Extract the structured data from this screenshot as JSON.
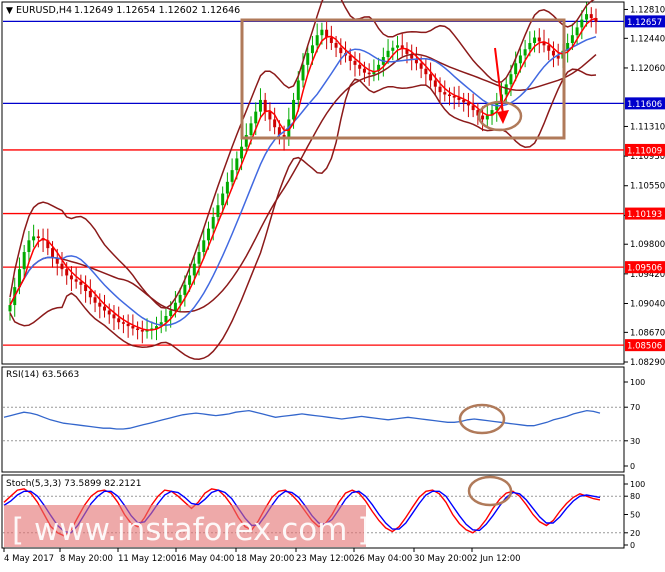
{
  "chart_data": [
    {
      "panel": "price",
      "type": "candlestick",
      "symbol_header": "EURUSD,H4",
      "ohlc_header": "1.12649 1.12654 1.12602 1.12646",
      "ylim": [
        1.0829,
        1.1288
      ],
      "price_ticks": [
        "1.12810",
        "1.12440",
        "1.12060",
        "1.11310",
        "1.10930",
        "1.10550",
        "1.10170",
        "1.09800",
        "1.09420",
        "1.09040",
        "1.08670",
        "1.08290"
      ],
      "horizontal_levels": [
        {
          "value": 1.12657,
          "label": "1.12657",
          "color": "#0000cc",
          "style": "line"
        },
        {
          "value": 1.11606,
          "label": "1.11606",
          "color": "#0000cc",
          "style": "line"
        },
        {
          "value": 1.11009,
          "label": "1.11009",
          "color": "#ff0000",
          "style": "line"
        },
        {
          "value": 1.10193,
          "label": "1.10193",
          "color": "#ff0000",
          "style": "line"
        },
        {
          "value": 1.09506,
          "label": "1.09506",
          "color": "#ff0000",
          "style": "line"
        },
        {
          "value": 1.08506,
          "label": "1.08506",
          "color": "#ff0000",
          "style": "line"
        }
      ],
      "x_labels": [
        "4 May 2017",
        "8 May 20:00",
        "11 May 12:00",
        "16 May 04:00",
        "18 May 20:00",
        "23 May 12:00",
        "26 May 04:00",
        "30 May 20:00",
        "2 Jun 12:00"
      ],
      "annotations": [
        "consolidation-rectangle",
        "target-circle",
        "down-arrow"
      ],
      "close_path": [
        1.0902,
        1.0925,
        1.0948,
        1.097,
        1.0985,
        1.099,
        1.0988,
        1.0985,
        1.0975,
        1.0962,
        1.0955,
        1.0948,
        1.094,
        1.0935,
        1.0932,
        1.0928,
        1.092,
        1.0912,
        1.0905,
        1.09,
        1.0895,
        1.089,
        1.0885,
        1.088,
        1.0878,
        1.0875,
        1.0872,
        1.087,
        1.0868,
        1.087,
        1.0872,
        1.0875,
        1.088,
        1.0888,
        1.0895,
        1.0905,
        1.0915,
        1.0928,
        1.094,
        1.0955,
        1.097,
        1.0985,
        1.1,
        1.1015,
        1.103,
        1.1045,
        1.106,
        1.1075,
        1.109,
        1.1105,
        1.112,
        1.1135,
        1.115,
        1.1165,
        1.115,
        1.114,
        1.113,
        1.112,
        1.1115,
        1.114,
        1.1165,
        1.119,
        1.121,
        1.1225,
        1.1235,
        1.1248,
        1.1255,
        1.1245,
        1.1238,
        1.1232,
        1.1225,
        1.1222,
        1.1215,
        1.121,
        1.1205,
        1.12,
        1.1198,
        1.1202,
        1.121,
        1.122,
        1.1228,
        1.1232,
        1.1235,
        1.123,
        1.1224,
        1.1218,
        1.1212,
        1.1205,
        1.1198,
        1.119,
        1.1182,
        1.1175,
        1.1172,
        1.117,
        1.1168,
        1.1165,
        1.1162,
        1.1158,
        1.1152,
        1.1145,
        1.114,
        1.1145,
        1.1152,
        1.1162,
        1.1172,
        1.1185,
        1.1198,
        1.1212,
        1.1222,
        1.123,
        1.1238,
        1.1245,
        1.124,
        1.1235,
        1.1228,
        1.1222,
        1.1218,
        1.1228,
        1.1238,
        1.1248,
        1.1258,
        1.1268,
        1.1275,
        1.127,
        1.1265
      ]
    },
    {
      "panel": "rsi",
      "type": "line",
      "title": "RSI(14) 63.5663",
      "ylim": [
        0,
        100
      ],
      "ticks": [
        "100",
        "70",
        "30",
        "0"
      ],
      "levels": [
        70,
        30
      ],
      "color": "#3366cc",
      "values": [
        58,
        60,
        62,
        64,
        63,
        61,
        58,
        55,
        53,
        51,
        50,
        49,
        48,
        47,
        46,
        45,
        45,
        44,
        44,
        45,
        47,
        49,
        51,
        53,
        55,
        57,
        59,
        61,
        62,
        63,
        62,
        61,
        60,
        61,
        62,
        64,
        65,
        66,
        64,
        62,
        60,
        58,
        59,
        60,
        61,
        62,
        61,
        60,
        59,
        58,
        57,
        56,
        57,
        58,
        59,
        58,
        57,
        56,
        55,
        56,
        57,
        58,
        57,
        56,
        55,
        54,
        53,
        52,
        52,
        53,
        55,
        56,
        55,
        54,
        53,
        52,
        51,
        50,
        49,
        48,
        48,
        50,
        52,
        55,
        57,
        59,
        62,
        64,
        66,
        65,
        63
      ]
    },
    {
      "panel": "stochastic",
      "type": "line",
      "title": "Stoch(5,3,3) 73.5899 82.2121",
      "ylim": [
        0,
        100
      ],
      "ticks": [
        "100",
        "80",
        "50",
        "20",
        "0"
      ],
      "levels": [
        80,
        20
      ],
      "series": [
        {
          "color": "#ff0000",
          "values": [
            70,
            80,
            90,
            92,
            85,
            70,
            50,
            30,
            20,
            15,
            25,
            45,
            65,
            80,
            88,
            90,
            85,
            70,
            50,
            35,
            30,
            45,
            65,
            80,
            90,
            88,
            80,
            70,
            60,
            70,
            85,
            92,
            90,
            80,
            65,
            45,
            30,
            25,
            40,
            60,
            78,
            88,
            90,
            82,
            70,
            55,
            40,
            30,
            35,
            50,
            70,
            85,
            90,
            85,
            72,
            55,
            40,
            28,
            22,
            30,
            45,
            62,
            78,
            88,
            90,
            84,
            70,
            50,
            35,
            25,
            20,
            28,
            42,
            60,
            75,
            85,
            88,
            80,
            66,
            50,
            38,
            32,
            40,
            55,
            68,
            78,
            84,
            80,
            76,
            74
          ]
        },
        {
          "color": "#0000ff",
          "values": [
            65,
            72,
            82,
            88,
            88,
            80,
            65,
            48,
            32,
            22,
            20,
            32,
            50,
            68,
            80,
            88,
            88,
            80,
            65,
            48,
            36,
            38,
            52,
            68,
            82,
            88,
            86,
            78,
            68,
            66,
            75,
            86,
            90,
            86,
            76,
            60,
            44,
            32,
            33,
            48,
            65,
            80,
            88,
            86,
            78,
            64,
            48,
            36,
            34,
            42,
            58,
            75,
            86,
            88,
            80,
            66,
            50,
            36,
            26,
            26,
            36,
            52,
            68,
            82,
            88,
            88,
            80,
            64,
            48,
            34,
            25,
            24,
            34,
            48,
            64,
            78,
            86,
            84,
            74,
            60,
            46,
            36,
            36,
            46,
            60,
            72,
            80,
            82,
            80,
            78
          ]
        }
      ]
    }
  ],
  "watermark": "[ www.instaforex.com ]",
  "colors": {
    "bull": "#00aa00",
    "bear": "#cc0000",
    "blue_line": "#0000cc",
    "red_line": "#ff0000",
    "box": "#a0522d",
    "bollinger": "#8b1a1a",
    "ma_blue": "#4169e1",
    "ma_red": "#ff0000",
    "watermark": "#e04040"
  }
}
